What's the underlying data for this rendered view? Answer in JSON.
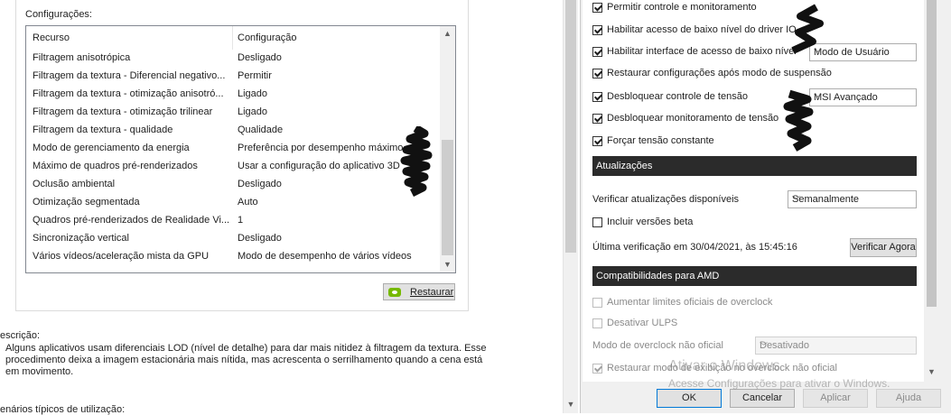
{
  "nvidia": {
    "config_label": "Configurações:",
    "columns": {
      "feature": "Recurso",
      "setting": "Configuração"
    },
    "rows": [
      {
        "feature": "Filtragem anisotrópica",
        "setting": "Desligado"
      },
      {
        "feature": "Filtragem da textura - Diferencial negativo...",
        "setting": "Permitir"
      },
      {
        "feature": "Filtragem da textura - otimização anisotró...",
        "setting": "Ligado"
      },
      {
        "feature": "Filtragem da textura - otimização trilinear",
        "setting": "Ligado"
      },
      {
        "feature": "Filtragem da textura - qualidade",
        "setting": "Qualidade"
      },
      {
        "feature": "Modo de gerenciamento da energia",
        "setting": "Preferência por desempenho máximo"
      },
      {
        "feature": "Máximo de quadros pré-renderizados",
        "setting": "Usar a configuração do aplicativo 3D"
      },
      {
        "feature": "Oclusão ambiental",
        "setting": "Desligado"
      },
      {
        "feature": "Otimização segmentada",
        "setting": "Auto"
      },
      {
        "feature": "Quadros pré-renderizados de Realidade Vi...",
        "setting": "1"
      },
      {
        "feature": "Sincronização vertical",
        "setting": "Desligado"
      },
      {
        "feature": "Vários vídeos/aceleração mista da GPU",
        "setting": "Modo de desempenho de vários vídeos"
      }
    ],
    "restore_button": "Restaurar",
    "description_label": "escrição:",
    "description_text": "Alguns aplicativos usam diferenciais LOD (nível de detalhe) para dar mais nitidez à filtragem da textura. Esse procedimento deixa a imagem estacionária mais nítida, mas acrescenta o serrilhamento quando a cena está em movimento.",
    "usage_label": "enários típicos de utilização:"
  },
  "afterburner": {
    "options": [
      {
        "label": "Permitir controle e monitoramento",
        "checked": true
      },
      {
        "label": "Habilitar acesso de baixo nível do driver IO",
        "checked": true
      },
      {
        "label": "Habilitar interface de acesso de baixo nível",
        "checked": true
      },
      {
        "label": "Restaurar configurações após modo de suspensão",
        "checked": true
      },
      {
        "label": "Desbloquear controle de tensão",
        "checked": true
      },
      {
        "label": "Desbloquear monitoramento de tensão",
        "checked": true
      },
      {
        "label": "Forçar tensão constante",
        "checked": true
      }
    ],
    "low_level_mode": "Modo de Usuário",
    "voltage_mode": "MSI Avançado",
    "updates_header": "Atualizações",
    "check_updates_label": "Verificar atualizações disponíveis",
    "check_updates_value": "Semanalmente",
    "beta_label": "Incluir versões beta",
    "last_check": "Última verificação em 30/04/2021, às 15:45:16",
    "check_now_button": "Verificar Agora",
    "amd_header": "Compatibilidades para AMD",
    "amd_options": [
      {
        "label": "Aumentar limites oficiais de overclock",
        "checked": false
      },
      {
        "label": "Desativar ULPS",
        "checked": false
      }
    ],
    "oc_mode_label": "Modo de overclock não oficial",
    "oc_mode_value": "Desativado",
    "restore_oc_label": "Restaurar modo de exibição no overclock não oficial",
    "buttons": {
      "ok": "OK",
      "cancel": "Cancelar",
      "apply": "Aplicar",
      "help": "Ajuda"
    }
  },
  "watermark": {
    "line1": "Ativar o Windows",
    "line2": "Acesse Configurações para ativar o Windows."
  },
  "colors": {
    "section_header_bg": "#2b2b2b",
    "nvidia_green": "#76b900",
    "dialog_bg": "#f0f0f0"
  },
  "icons": [
    "nvidia-logo-icon",
    "checkbox-icon",
    "chevron-down-icon",
    "scroll-up-icon",
    "scroll-down-icon"
  ]
}
